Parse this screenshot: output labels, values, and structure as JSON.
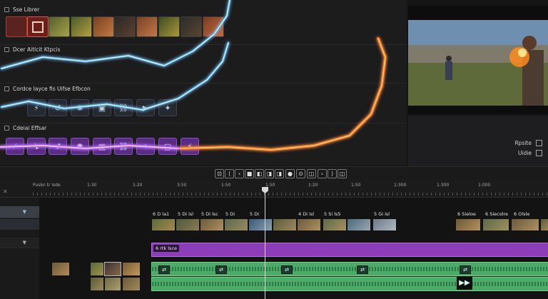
{
  "browser": {
    "sections": [
      {
        "title": "Sse Librer"
      },
      {
        "title": "Dcer Aitlcit Ktpcis"
      },
      {
        "title": "Cordce Iayce fis Uifse Efbcon"
      },
      {
        "title": "Cdeiai Effsar"
      }
    ]
  },
  "preview": {
    "checkboxes": [
      {
        "label": "Rpsite"
      },
      {
        "label": "Uidie"
      }
    ]
  },
  "transport": {
    "buttons": [
      "⊡",
      "⟨",
      "‹",
      "■",
      "◧",
      "◨",
      "●",
      "⊙",
      "›",
      "⟩",
      "◫"
    ]
  },
  "timeline": {
    "timecode": "Puskn tr lsde",
    "ticks": [
      "1:30",
      "1:20",
      "3:50",
      "1:50",
      "1:50",
      "1:20",
      "1:50",
      "1:300",
      "1:300",
      "1:000"
    ],
    "clip_labels_row1": [
      "6 D la1",
      "5 Di isl",
      "5 Di lsc",
      "5 Di",
      "5 Di",
      "4 Di isl",
      "5 Si ls5",
      "5 Gi isl",
      "6 Sieloe",
      "6 Siecolre",
      "6 Olsle"
    ],
    "purple_label": "6 rtk lsce"
  },
  "colors": {
    "accent_purple": "#8e3db8",
    "accent_green": "#4dab6a",
    "bolt_blue": "#3fb2ff",
    "bolt_orange": "#ff6a1a"
  }
}
